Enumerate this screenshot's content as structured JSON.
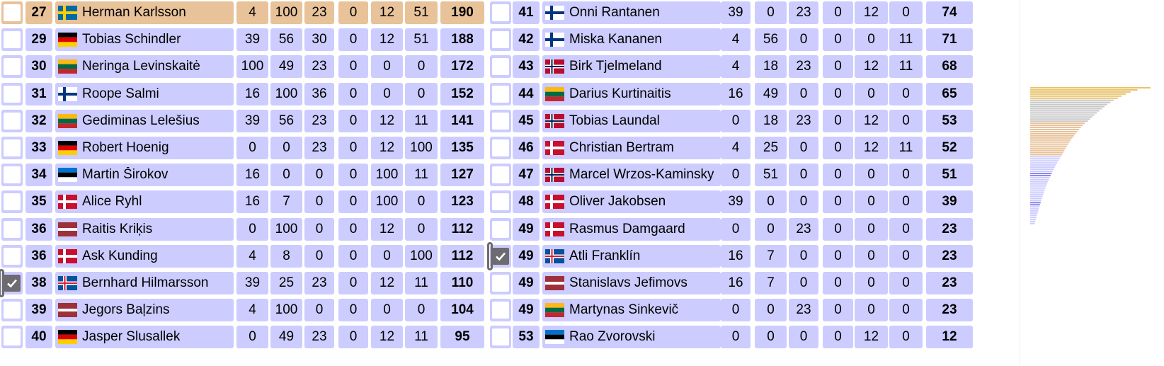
{
  "colors": {
    "row": "#ccccff",
    "top_row": "#e8c299",
    "selected_border": "#6d6a70",
    "bar_top": "#e8c46a",
    "bar_grey": "#c8c8c8",
    "bar_orange": "#e8c299",
    "bar_blue": "#ccccff",
    "bar_selected": "#8888ee"
  },
  "icons": {
    "checkbox": "check-icon"
  },
  "rows": [
    {
      "rank": "27",
      "flag": "se",
      "name": "Herman Karlsson",
      "scores": [
        "4",
        "100",
        "23",
        "0",
        "12",
        "51"
      ],
      "total": "190",
      "checked": false,
      "top": true
    },
    {
      "rank": "29",
      "flag": "de",
      "name": "Tobias Schindler",
      "scores": [
        "39",
        "56",
        "30",
        "0",
        "12",
        "51"
      ],
      "total": "188",
      "checked": false
    },
    {
      "rank": "30",
      "flag": "lt",
      "name": "Neringa Levinskaitė",
      "scores": [
        "100",
        "49",
        "23",
        "0",
        "0",
        "0"
      ],
      "total": "172",
      "checked": false
    },
    {
      "rank": "31",
      "flag": "fi",
      "name": "Roope Salmi",
      "scores": [
        "16",
        "100",
        "36",
        "0",
        "0",
        "0"
      ],
      "total": "152",
      "checked": false
    },
    {
      "rank": "32",
      "flag": "lt",
      "name": "Gediminas Lelešius",
      "scores": [
        "39",
        "56",
        "23",
        "0",
        "12",
        "11"
      ],
      "total": "141",
      "checked": false
    },
    {
      "rank": "33",
      "flag": "de",
      "name": "Robert Hoenig",
      "scores": [
        "0",
        "0",
        "23",
        "0",
        "12",
        "100"
      ],
      "total": "135",
      "checked": false
    },
    {
      "rank": "34",
      "flag": "ee",
      "name": "Martin Širokov",
      "scores": [
        "16",
        "0",
        "0",
        "0",
        "100",
        "11"
      ],
      "total": "127",
      "checked": false
    },
    {
      "rank": "35",
      "flag": "dk",
      "name": "Alice Ryhl",
      "scores": [
        "16",
        "7",
        "0",
        "0",
        "100",
        "0"
      ],
      "total": "123",
      "checked": false
    },
    {
      "rank": "36",
      "flag": "lv",
      "name": "Raitis Kriķis",
      "scores": [
        "0",
        "100",
        "0",
        "0",
        "12",
        "0"
      ],
      "total": "112",
      "checked": false
    },
    {
      "rank": "36",
      "flag": "dk",
      "name": "Ask Kunding",
      "scores": [
        "4",
        "8",
        "0",
        "0",
        "0",
        "100"
      ],
      "total": "112",
      "checked": false
    },
    {
      "rank": "38",
      "flag": "is",
      "name": "Bernhard Hilmarsson",
      "scores": [
        "39",
        "25",
        "23",
        "0",
        "12",
        "11"
      ],
      "total": "110",
      "checked": true
    },
    {
      "rank": "39",
      "flag": "lv",
      "name": "Jegors Baļzins",
      "scores": [
        "4",
        "100",
        "0",
        "0",
        "0",
        "0"
      ],
      "total": "104",
      "checked": false
    },
    {
      "rank": "40",
      "flag": "de",
      "name": "Jasper Slusallek",
      "scores": [
        "0",
        "49",
        "23",
        "0",
        "12",
        "11"
      ],
      "total": "95",
      "checked": false
    },
    {
      "rank": "41",
      "flag": "fi",
      "name": "Onni Rantanen",
      "scores": [
        "39",
        "0",
        "23",
        "0",
        "12",
        "0"
      ],
      "total": "74",
      "checked": false
    },
    {
      "rank": "42",
      "flag": "fi",
      "name": "Miska Kananen",
      "scores": [
        "4",
        "56",
        "0",
        "0",
        "0",
        "11"
      ],
      "total": "71",
      "checked": false
    },
    {
      "rank": "43",
      "flag": "no",
      "name": "Birk Tjelmeland",
      "scores": [
        "4",
        "18",
        "23",
        "0",
        "12",
        "11"
      ],
      "total": "68",
      "checked": false
    },
    {
      "rank": "44",
      "flag": "lt",
      "name": "Darius Kurtinaitis",
      "scores": [
        "16",
        "49",
        "0",
        "0",
        "0",
        "0"
      ],
      "total": "65",
      "checked": false
    },
    {
      "rank": "45",
      "flag": "no",
      "name": "Tobias Laundal",
      "scores": [
        "0",
        "18",
        "23",
        "0",
        "12",
        "0"
      ],
      "total": "53",
      "checked": false
    },
    {
      "rank": "46",
      "flag": "dk",
      "name": "Christian Bertram",
      "scores": [
        "4",
        "25",
        "0",
        "0",
        "12",
        "11"
      ],
      "total": "52",
      "checked": false
    },
    {
      "rank": "47",
      "flag": "no",
      "name": "Marcel Wrzos-Kaminsky",
      "scores": [
        "0",
        "51",
        "0",
        "0",
        "0",
        "0"
      ],
      "total": "51",
      "checked": false
    },
    {
      "rank": "48",
      "flag": "dk",
      "name": "Oliver Jakobsen",
      "scores": [
        "39",
        "0",
        "0",
        "0",
        "0",
        "0"
      ],
      "total": "39",
      "checked": false
    },
    {
      "rank": "49",
      "flag": "dk",
      "name": "Rasmus Damgaard",
      "scores": [
        "0",
        "0",
        "23",
        "0",
        "0",
        "0"
      ],
      "total": "23",
      "checked": false
    },
    {
      "rank": "49",
      "flag": "is",
      "name": "Atli Franklín",
      "scores": [
        "16",
        "7",
        "0",
        "0",
        "0",
        "0"
      ],
      "total": "23",
      "checked": true
    },
    {
      "rank": "49",
      "flag": "lv",
      "name": "Stanislavs Jefimovs",
      "scores": [
        "16",
        "7",
        "0",
        "0",
        "0",
        "0"
      ],
      "total": "23",
      "checked": false
    },
    {
      "rank": "49",
      "flag": "lt",
      "name": "Martynas Sinkevič",
      "scores": [
        "0",
        "0",
        "23",
        "0",
        "0",
        "0"
      ],
      "total": "23",
      "checked": false
    },
    {
      "rank": "53",
      "flag": "ee",
      "name": "Rao Zvorovski",
      "scores": [
        "0",
        "0",
        "0",
        "0",
        "12",
        "0"
      ],
      "total": "12",
      "checked": false
    }
  ],
  "distribution": {
    "groups": [
      {
        "color": "#e8c46a",
        "values": [
          600,
          590,
          580,
          575,
          570,
          565
        ]
      },
      {
        "color": "#c8c8c8",
        "values": [
          555,
          550,
          545,
          540,
          535,
          530,
          525,
          520,
          515,
          510,
          505
        ]
      },
      {
        "color": "#e8c299",
        "values": [
          490,
          485,
          480,
          475,
          470,
          465,
          460,
          455,
          450,
          447,
          444,
          441,
          438,
          435,
          432,
          430
        ]
      },
      {
        "color": "#ccccff",
        "values": [
          425,
          420,
          415,
          410,
          405,
          400,
          395,
          390
        ]
      },
      {
        "color": "#8888ee",
        "values": [
          385,
          380
        ]
      },
      {
        "color": "#ccccff",
        "values": [
          375,
          370,
          365,
          362,
          360,
          358,
          356,
          354,
          352,
          350,
          348,
          346
        ]
      },
      {
        "color": "#8888ee",
        "values": [
          344,
          342
        ]
      },
      {
        "color": "#ccccff",
        "values": [
          340,
          338,
          336,
          334,
          333,
          332,
          331,
          330,
          329
        ]
      }
    ],
    "max": 600
  }
}
